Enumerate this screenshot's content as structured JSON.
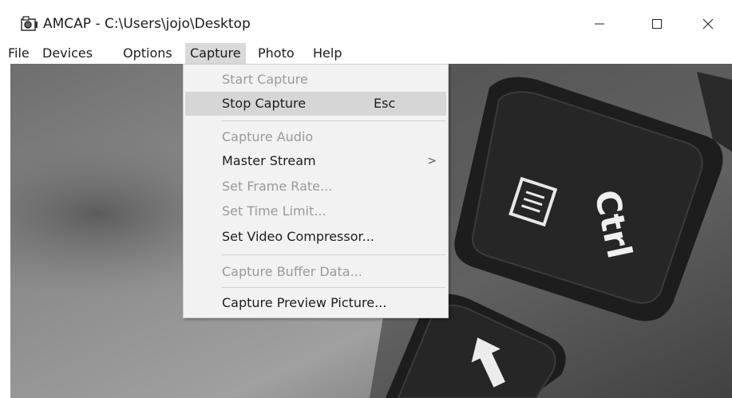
{
  "window": {
    "title": "AMCAP - C:\\Users\\jojo\\Desktop"
  },
  "menubar": {
    "items": [
      {
        "label": "File"
      },
      {
        "label": "Devices"
      },
      {
        "label": "Options"
      },
      {
        "label": "Capture"
      },
      {
        "label": "Photo"
      },
      {
        "label": "Help"
      }
    ],
    "active": "Capture"
  },
  "capture_menu": {
    "items": [
      {
        "label": "Start Capture",
        "enabled": false
      },
      {
        "label": "Stop Capture",
        "shortcut": "Esc",
        "enabled": true,
        "highlighted": true
      },
      {
        "label": "Capture Audio",
        "enabled": false
      },
      {
        "label": "Master Stream",
        "enabled": true,
        "submenu": true
      },
      {
        "label": "Set Frame Rate...",
        "enabled": false
      },
      {
        "label": "Set Time Limit...",
        "enabled": false
      },
      {
        "label": "Set Video Compressor...",
        "enabled": true
      },
      {
        "label": "Capture Buffer Data...",
        "enabled": false
      },
      {
        "label": "Capture Preview Picture...",
        "enabled": true
      }
    ],
    "submenu_arrow": ">"
  },
  "preview": {
    "key_labels": {
      "ctrl": "Ctrl"
    }
  },
  "icons": {
    "app": "camera-icon",
    "minimize": "minimize-icon",
    "maximize": "maximize-icon",
    "close": "close-icon"
  }
}
